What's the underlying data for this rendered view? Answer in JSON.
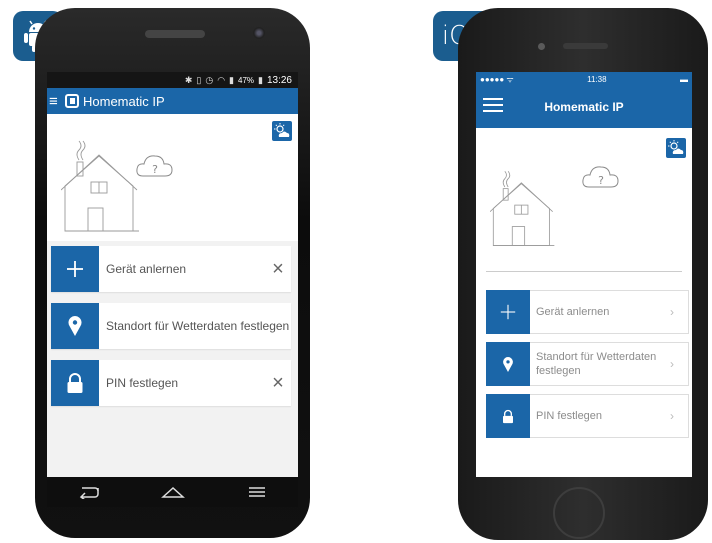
{
  "badges": {
    "android": "android-robot-icon",
    "ios_label": "iOS"
  },
  "android": {
    "status": {
      "battery_pct": "47%",
      "time": "13:26"
    },
    "app_title": "Homematic IP",
    "items": [
      {
        "label": "Gerät anlernen",
        "icon": "plus-icon",
        "trailing": "×"
      },
      {
        "label": "Standort für Wetterdaten festlegen",
        "icon": "location-pin-icon",
        "trailing": ""
      },
      {
        "label": "PIN festlegen",
        "icon": "lock-icon",
        "trailing": "×"
      }
    ],
    "cloud_mark": "?"
  },
  "ios": {
    "status": {
      "carrier": "●●●●● ᯤ",
      "time": "11:38",
      "battery": "▬"
    },
    "app_title": "Homematic IP",
    "items": [
      {
        "label": "Gerät anlernen",
        "icon": "plus-icon",
        "trailing": "›"
      },
      {
        "label": "Standort für Wetterdaten festlegen",
        "icon": "location-pin-icon",
        "trailing": "›"
      },
      {
        "label": "PIN festlegen",
        "icon": "lock-icon",
        "trailing": "›"
      }
    ],
    "cloud_mark": "?"
  },
  "colors": {
    "brand": "#1b66a8",
    "badge": "#1b5d8f"
  }
}
